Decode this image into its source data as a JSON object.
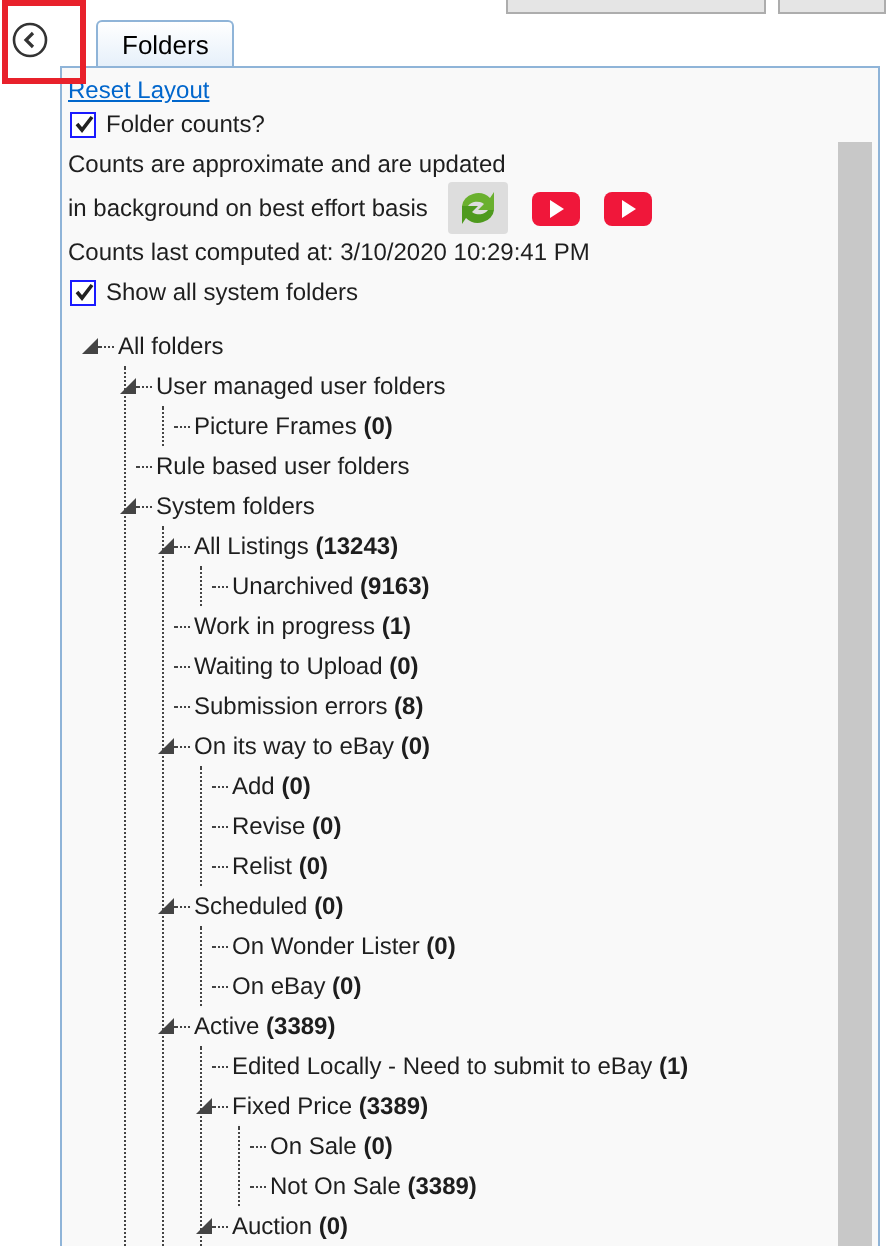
{
  "back_button": {
    "highlighted": true
  },
  "tabs": [
    {
      "label": "Folders",
      "selected": true
    }
  ],
  "reset_link": "Reset Layout",
  "options": [
    {
      "label": "Folder counts?",
      "checked": true
    }
  ],
  "note_lines": [
    "Counts are approximate and are updated",
    "in background on best effort basis"
  ],
  "last_computed": "Counts last computed at: 3/10/2020 10:29:41 PM",
  "show_system": {
    "label": "Show all system folders",
    "checked": true
  },
  "tree": [
    {
      "label": "All folders",
      "expanded": true,
      "children": [
        {
          "label": "User managed user folders",
          "expanded": true,
          "children": [
            {
              "label": "Picture Frames",
              "count": "(0)"
            }
          ]
        },
        {
          "label": "Rule based user folders"
        },
        {
          "label": "System folders",
          "expanded": true,
          "children": [
            {
              "label": "All Listings",
              "count": "(13243)",
              "expanded": true,
              "children": [
                {
                  "label": "Unarchived",
                  "count": "(9163)"
                }
              ]
            },
            {
              "label": "Work in progress",
              "count": "(1)"
            },
            {
              "label": "Waiting to Upload",
              "count": "(0)"
            },
            {
              "label": "Submission errors",
              "count": "(8)"
            },
            {
              "label": "On its way to eBay",
              "count": "(0)",
              "expanded": true,
              "children": [
                {
                  "label": "Add",
                  "count": "(0)"
                },
                {
                  "label": "Revise",
                  "count": "(0)"
                },
                {
                  "label": "Relist",
                  "count": "(0)"
                }
              ]
            },
            {
              "label": "Scheduled",
              "count": "(0)",
              "expanded": true,
              "children": [
                {
                  "label": "On Wonder Lister",
                  "count": "(0)"
                },
                {
                  "label": "On eBay",
                  "count": "(0)"
                }
              ]
            },
            {
              "label": "Active",
              "count": "(3389)",
              "expanded": true,
              "children": [
                {
                  "label": "Edited Locally - Need to submit to eBay",
                  "count": "(1)"
                },
                {
                  "label": "Fixed Price",
                  "count": "(3389)",
                  "expanded": true,
                  "children": [
                    {
                      "label": "On Sale",
                      "count": "(0)"
                    },
                    {
                      "label": "Not On Sale",
                      "count": "(3389)"
                    }
                  ]
                },
                {
                  "label": "Auction",
                  "count": "(0)",
                  "expanded": true
                }
              ]
            }
          ]
        }
      ]
    }
  ]
}
